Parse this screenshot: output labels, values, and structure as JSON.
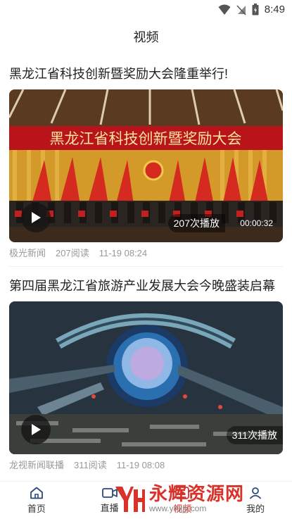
{
  "status_bar": {
    "time": "8:49"
  },
  "header": {
    "title": "视频"
  },
  "feed": [
    {
      "title": "黑龙江省科技创新暨奖励大会隆重举行!",
      "banner_text": "黑龙江省科技创新暨奖励大会",
      "views_badge": "207次播放",
      "duration": "00:00:32",
      "source": "极光新闻",
      "reads": "207阅读",
      "time": "11-19 08:24"
    },
    {
      "title": "第四届黑龙江省旅游产业发展大会今晚盛装启幕",
      "views_badge": "311次播放",
      "source": "龙视新闻联播",
      "reads": "311阅读",
      "time": "11-19 08:08"
    }
  ],
  "tabbar": {
    "tabs": [
      {
        "label": "首页",
        "icon": "home-icon"
      },
      {
        "label": "直播",
        "icon": "video-camera-icon"
      },
      {
        "label": "视频",
        "icon": "play-icon",
        "active": true
      },
      {
        "label": "我的",
        "icon": "user-icon"
      }
    ]
  },
  "watermark": {
    "text": "永辉资源网",
    "url": "www.yhkjjj.com"
  },
  "colors": {
    "accent": "#d9322b",
    "banner_red": "#b8141a",
    "stage_blue": "#2a6fb0"
  }
}
